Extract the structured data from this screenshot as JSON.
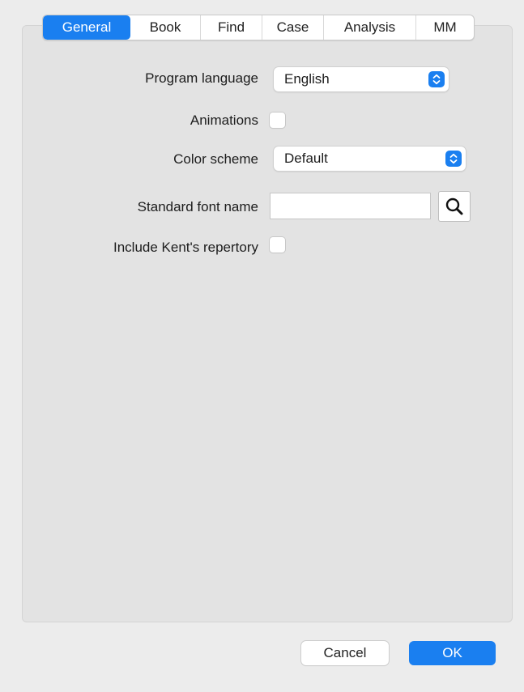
{
  "tabs": [
    {
      "label": "General",
      "active": true
    },
    {
      "label": "Book",
      "active": false
    },
    {
      "label": "Find",
      "active": false
    },
    {
      "label": "Case",
      "active": false
    },
    {
      "label": "Analysis",
      "active": false
    },
    {
      "label": "MM",
      "active": false
    }
  ],
  "settings": {
    "program_language": {
      "label": "Program language",
      "value": "English"
    },
    "animations": {
      "label": "Animations",
      "checked": false
    },
    "color_scheme": {
      "label": "Color scheme",
      "value": "Default"
    },
    "standard_font_name": {
      "label": "Standard font name",
      "value": ""
    },
    "include_kents_repertory": {
      "label": "Include Kent's repertory",
      "checked": false
    }
  },
  "buttons": {
    "cancel": "Cancel",
    "ok": "OK"
  },
  "icons": {
    "popup": "chevron-updown-icon",
    "search": "search-icon"
  },
  "colors": {
    "accent": "#1a7ff0",
    "background": "#ececec",
    "panel": "#e3e3e3"
  }
}
